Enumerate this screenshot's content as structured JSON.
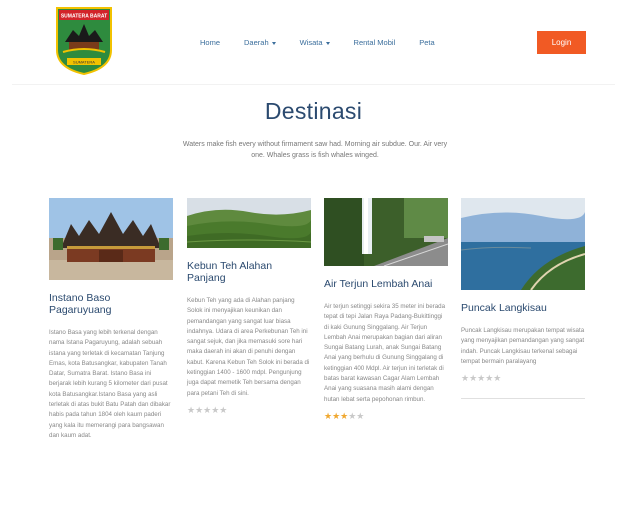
{
  "brand": {
    "logo_text_top": "SUMATERA BARAT",
    "logo_text_bottom": "SUMATERA"
  },
  "nav": {
    "items": [
      {
        "label": "Home",
        "dropdown": false
      },
      {
        "label": "Daerah",
        "dropdown": true
      },
      {
        "label": "Wisata",
        "dropdown": true
      },
      {
        "label": "Rental Mobil",
        "dropdown": false
      },
      {
        "label": "Peta",
        "dropdown": false
      }
    ],
    "login_label": "Login"
  },
  "colors": {
    "accent": "#f15a24",
    "heading": "#2b4a6f",
    "link": "#3b6e9c",
    "star_on": "#f0a830",
    "star_off": "#c9c9c9"
  },
  "section": {
    "title": "Destinasi",
    "subtitle": "Waters make fish every without firmament saw had. Morning air subdue. Our. Air very one. Whales grass is fish whales winged."
  },
  "cards": [
    {
      "title": "Instano Baso Pagaruyuang",
      "text": "Istano Basa yang lebih terkenal dengan nama Istana Pagaruyung, adalah sebuah istana yang terletak di kecamatan Tanjung Emas, kota Batusangkar, kabupaten Tanah Datar, Sumatra Barat. Istano Basa ini berjarak lebih kurang 5 kilometer dari pusat kota Batusangkar.Istano Basa yang asli terletak di atas bukit Batu Patah dan dibakar habis pada tahun 1804 oleh kaum paderi yang kala itu memerangi para bangsawan dan kaum adat.",
      "rating": 0,
      "image": "palace-image"
    },
    {
      "title": "Kebun Teh Alahan Panjang",
      "text": "Kebun Teh yang ada di Alahan panjang Solok ini menyajikan keunikan dan pemandangan yang sangat luar biasa indahnya. Udara di area Perkebunan Teh ini sangat sejuk, dan jika memasuki sore hari maka daerah ini akan di penuhi dengan kabut. Karena Kebun Teh Solok ini berada di ketinggian 1400 - 1600 mdpl. Pengunjung juga dapat memetik Teh bersama dengan para petani Teh di sini.",
      "rating": 0,
      "image": "tea-plantation-image"
    },
    {
      "title": "Air Terjun Lembah Anai",
      "text": "Air terjun setinggi sekira 35 meter ini berada tepat di tepi Jalan Raya Padang-Bukittinggi di kaki Gunung Singgalang. Air Terjun Lembah Anai merupakan bagian dari aliran Sungai Batang Lurah, anak Sungai Batang Anai yang berhulu di Gunung Singgalang di ketinggian 400 Mdpl. Air terjun ini terletak di batas barat kawasan Cagar Alam Lembah Anai yang suasana masih alami dengan hutan lebat serta pepohonan rimbun.",
      "rating": 3,
      "image": "waterfall-image"
    },
    {
      "title": "Puncak Langkisau",
      "text": "Puncak Langkisau merupakan tempat wisata yang menyajikan pemandangan yang sangat indah. Puncak Langkisau terkenal sebagai tempat bermain paralayang",
      "rating": 0,
      "image": "coastline-image"
    }
  ]
}
